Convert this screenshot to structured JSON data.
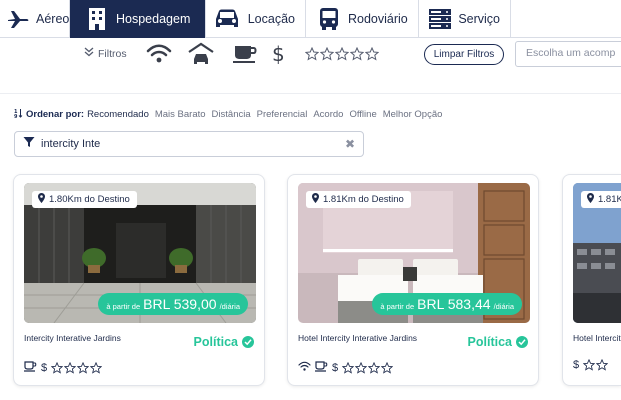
{
  "nav": {
    "tabs": [
      {
        "label": "Aéreo",
        "icon": "airplane-icon",
        "active": false
      },
      {
        "label": "Hospedagem",
        "icon": "building-icon",
        "active": true
      },
      {
        "label": "Locação",
        "icon": "car-icon",
        "active": false
      },
      {
        "label": "Rodoviário",
        "icon": "bus-icon",
        "active": false
      },
      {
        "label": "Serviço",
        "icon": "server-icon",
        "active": false
      }
    ]
  },
  "filters": {
    "label": "Filtros",
    "clear_label": "Limpar Filtros",
    "companion_placeholder": "Escolha um acomp"
  },
  "sort": {
    "label": "Ordenar por:",
    "options": [
      "Recomendado",
      "Mais Barato",
      "Distância",
      "Preferencial",
      "Acordo",
      "Offline",
      "Melhor Opção"
    ],
    "selected": "Recomendado"
  },
  "text_filter": {
    "value": "intercity Inte"
  },
  "hotels": [
    {
      "name": "Intercity Interative Jardins",
      "distance": "1.80Km do Destino",
      "price_prefix": "à partir de",
      "price": "BRL 539,00",
      "price_unit": "/diária",
      "policy": "Política"
    },
    {
      "name": "Hotel Intercity Interative Jardins",
      "distance": "1.81Km do Destino",
      "price_prefix": "à partir de",
      "price": "BRL 583,44",
      "price_unit": "/diária",
      "policy": "Política"
    },
    {
      "name": "Hotel Intercit",
      "distance": "1.81K"
    }
  ],
  "colors": {
    "nav_active": "#1b2a52",
    "accent_green": "#27c59a",
    "text_dark": "#1e2a4a"
  }
}
